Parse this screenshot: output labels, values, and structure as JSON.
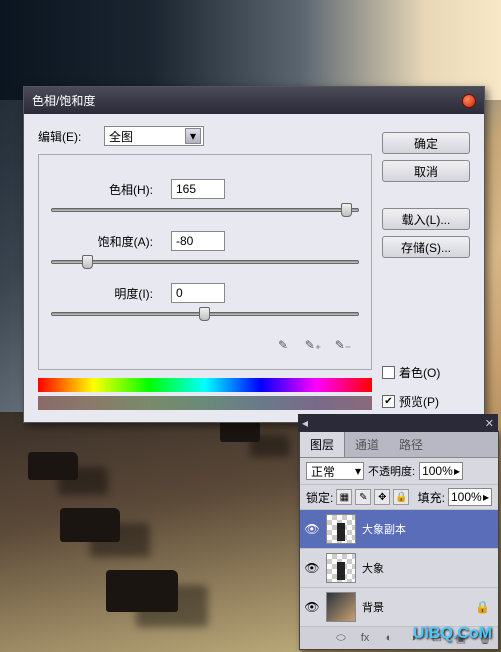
{
  "dialog": {
    "title": "色相/饱和度",
    "edit_label": "编辑(E):",
    "edit_value": "全图",
    "hue_label": "色相(H):",
    "hue_value": "165",
    "sat_label": "饱和度(A):",
    "sat_value": "-80",
    "light_label": "明度(I):",
    "light_value": "0",
    "colorize_label": "着色(O)",
    "preview_label": "预览(P)",
    "buttons": {
      "ok": "确定",
      "cancel": "取消",
      "load": "载入(L)...",
      "save": "存储(S)..."
    }
  },
  "panel": {
    "tabs": [
      "图层",
      "通道",
      "路径"
    ],
    "mode": "正常",
    "opacity_label": "不透明度:",
    "opacity_value": "100%",
    "lock_label": "锁定:",
    "fill_label": "填充:",
    "fill_value": "100%",
    "layers": [
      {
        "name": "大象副本"
      },
      {
        "name": "大象"
      },
      {
        "name": "背景"
      }
    ]
  },
  "watermark": "UiBQ.CoM"
}
